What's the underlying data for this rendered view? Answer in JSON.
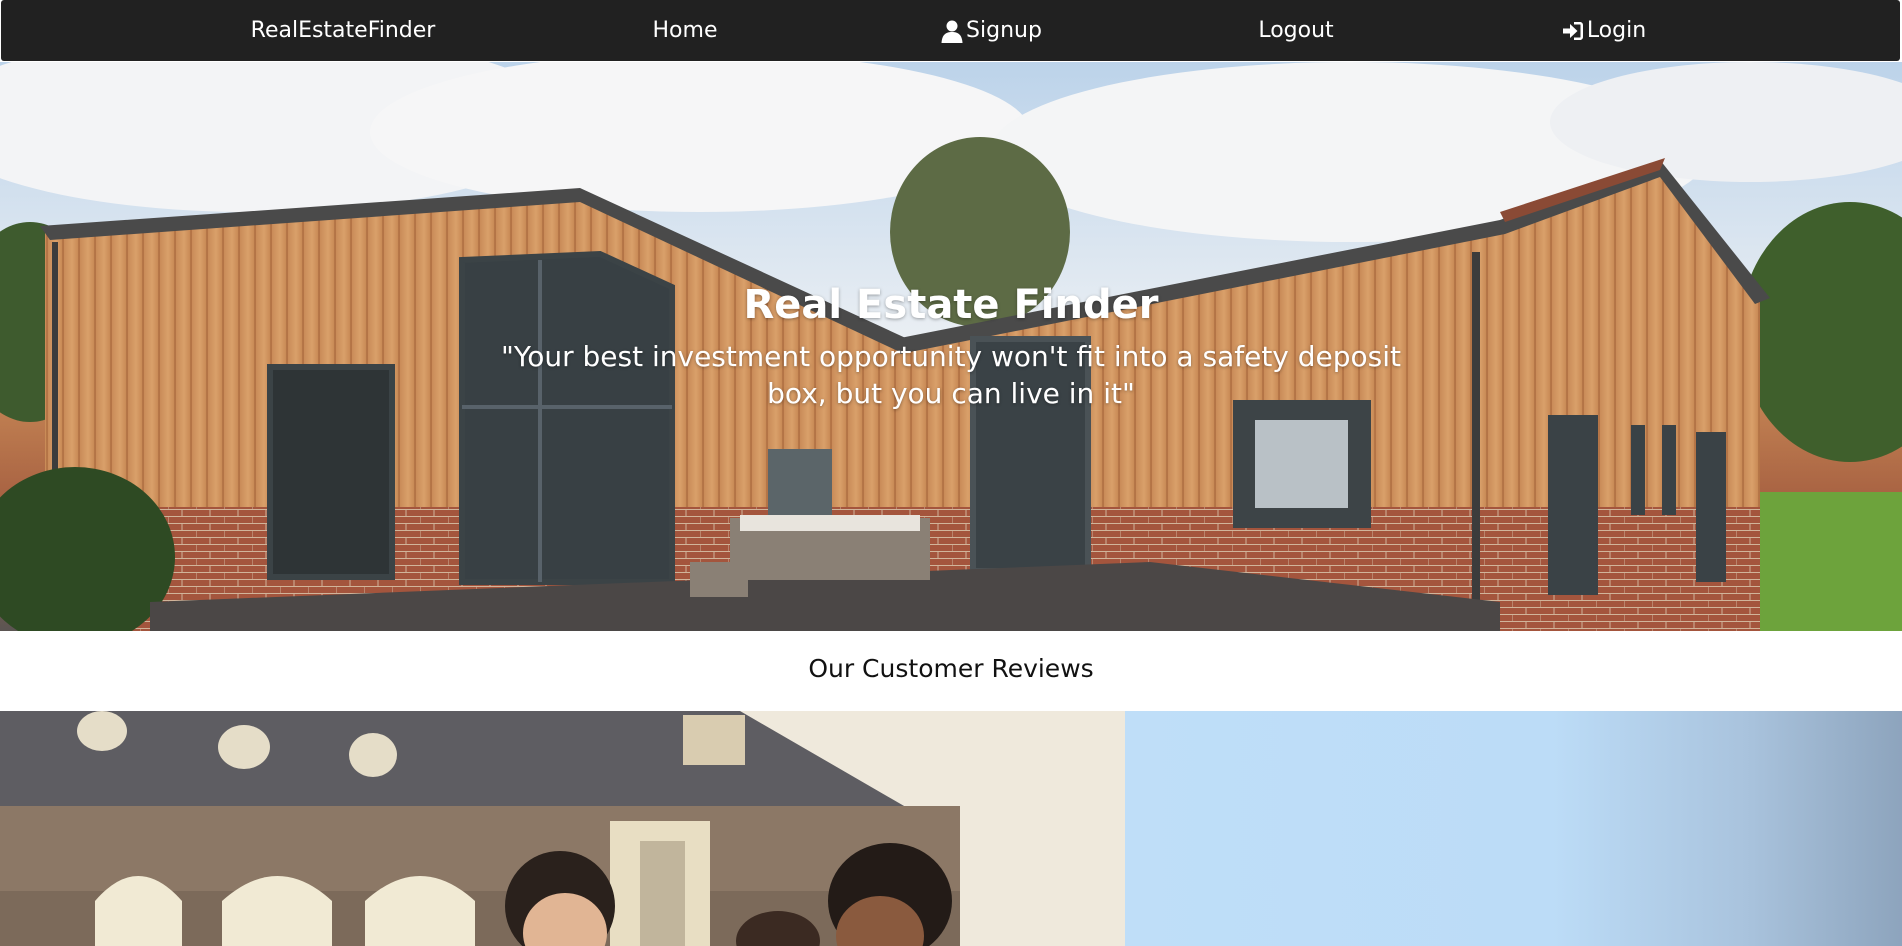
{
  "navbar": {
    "brand": "RealEstateFinder",
    "home": "Home",
    "signup": "Signup",
    "logout": "Logout",
    "login": "Login",
    "signup_icon": "user-icon",
    "login_icon": "sign-in-icon",
    "background": "#212121"
  },
  "hero": {
    "title": "Real Estate Finder",
    "quote": "\"Your best investment opportunity won't fit into a safety deposit box, but you can live in it\""
  },
  "reviews": {
    "heading": "Our Customer Reviews"
  },
  "colors": {
    "review_panel": "#bfdef8"
  }
}
